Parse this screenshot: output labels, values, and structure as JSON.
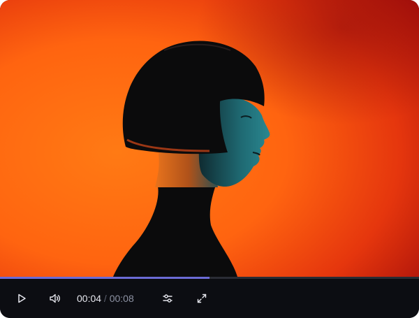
{
  "player": {
    "current_time": "00:04",
    "separator": " / ",
    "duration": "00:08",
    "progress_fraction": 0.5,
    "accent_color": "#6b6bd6",
    "controls": [
      {
        "name": "play-button",
        "icon": "play-icon"
      },
      {
        "name": "volume-button",
        "icon": "volume-icon"
      },
      {
        "name": "settings-button",
        "icon": "sliders-icon"
      },
      {
        "name": "fullscreen-button",
        "icon": "expand-icon"
      }
    ]
  },
  "video": {
    "description_colors": {
      "background_orange": "#ff6a10",
      "background_red": "#c21a0e",
      "silhouette": "#0b0b0c",
      "skin_teal": "#1e6c74"
    }
  }
}
